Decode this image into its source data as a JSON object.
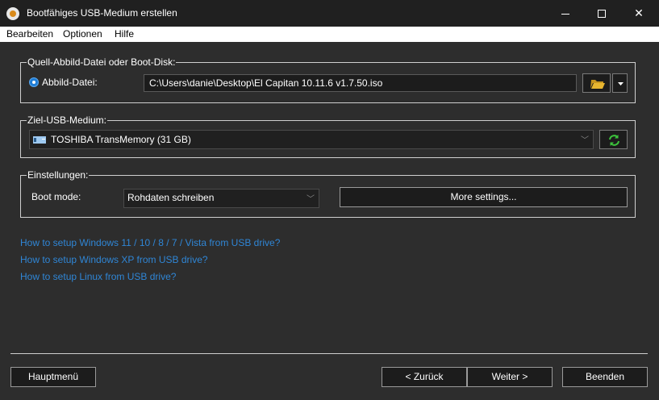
{
  "window": {
    "title": "Bootfähiges USB-Medium erstellen"
  },
  "menu": [
    "Bearbeiten",
    "Optionen",
    "Hilfe"
  ],
  "source_group": {
    "legend": "Quell-Abbild-Datei oder Boot-Disk:",
    "radio_label": "Abbild-Datei:",
    "path_value": "C:\\Users\\danie\\Desktop\\El Capitan 10.11.6 v1.7.50.iso",
    "browse_icon": "folder-open-icon",
    "dropdown_icon": "caret-down-icon"
  },
  "target_group": {
    "legend": "Ziel-USB-Medium:",
    "selected_drive": "TOSHIBA TransMemory (31 GB)",
    "refresh_icon": "refresh-icon"
  },
  "settings_group": {
    "legend": "Einstellungen:",
    "boot_mode_label": "Boot mode:",
    "boot_mode_value": "Rohdaten schreiben",
    "more_settings": "More settings..."
  },
  "links": [
    "How to setup Windows 11 / 10 / 8 / 7 / Vista from USB drive?",
    "How to setup Windows XP from USB drive?",
    "How to setup Linux from USB drive?"
  ],
  "footer": {
    "main_menu": "Hauptmenü",
    "back": "< Zurück",
    "next": "Weiter >",
    "exit": "Beenden"
  },
  "colors": {
    "accent": "#1e7dd6",
    "link": "#2f86d6",
    "refresh_green": "#3cc43c",
    "folder_yellow": "#e8b630"
  }
}
